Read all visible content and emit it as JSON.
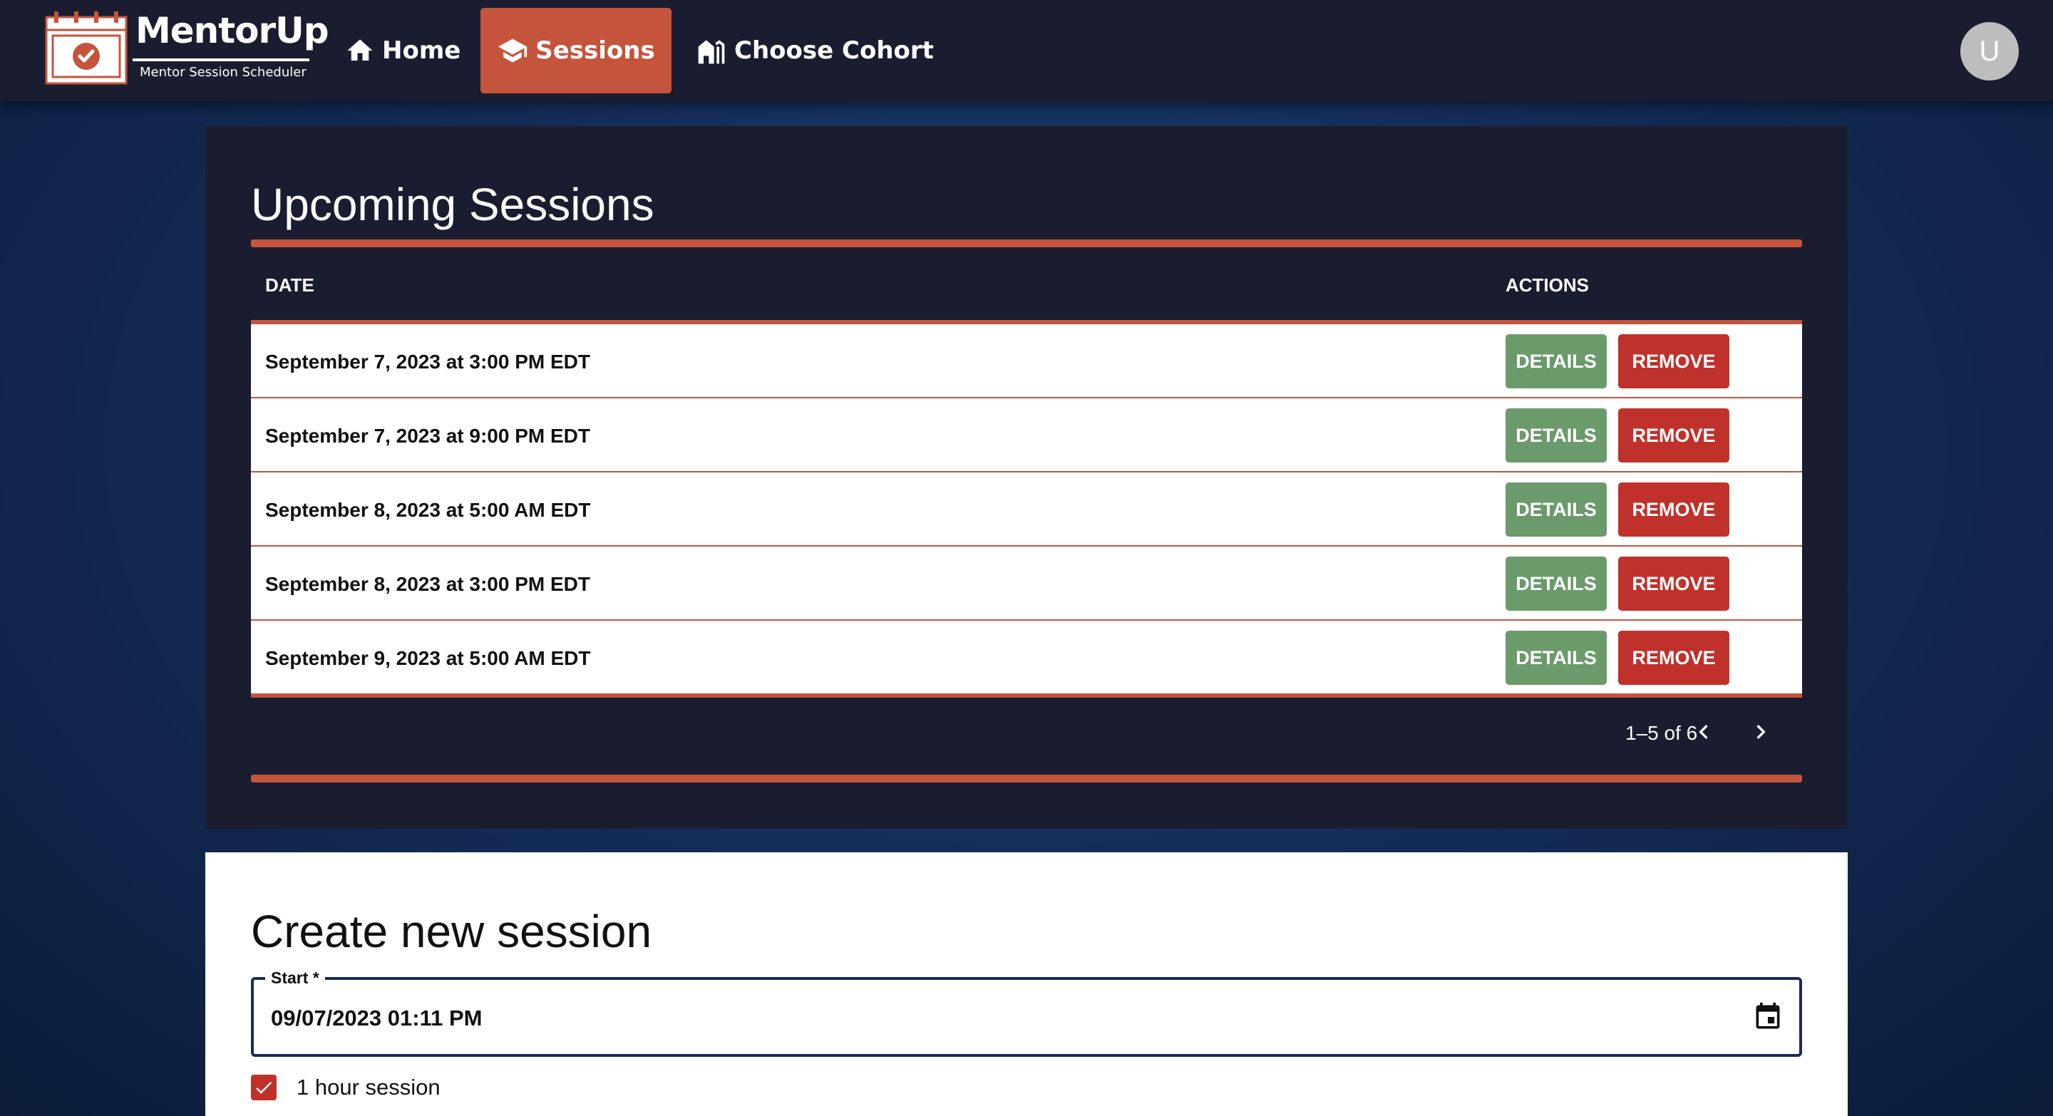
{
  "brand": {
    "name": "MentorUp",
    "tagline": "Mentor Session Scheduler"
  },
  "nav": {
    "home": "Home",
    "sessions": "Sessions",
    "cohort": "Choose Cohort",
    "active": "Sessions"
  },
  "user": {
    "avatar_initial": "U"
  },
  "upcoming": {
    "title": "Upcoming Sessions",
    "columns": {
      "date": "DATE",
      "actions": "ACTIONS"
    },
    "rows": [
      {
        "date": "September 7, 2023 at 3:00 PM EDT",
        "details": "DETAILS",
        "remove": "REMOVE"
      },
      {
        "date": "September 7, 2023 at 9:00 PM EDT",
        "details": "DETAILS",
        "remove": "REMOVE"
      },
      {
        "date": "September 8, 2023 at 5:00 AM EDT",
        "details": "DETAILS",
        "remove": "REMOVE"
      },
      {
        "date": "September 8, 2023 at 3:00 PM EDT",
        "details": "DETAILS",
        "remove": "REMOVE"
      },
      {
        "date": "September 9, 2023 at 5:00 AM EDT",
        "details": "DETAILS",
        "remove": "REMOVE"
      }
    ],
    "pagination": "1–5 of 6"
  },
  "create": {
    "title": "Create new session",
    "start_label": "Start *",
    "start_value": "09/07/2023 01:11 PM",
    "one_hour_label": "1 hour session",
    "one_hour_checked": true
  },
  "colors": {
    "accent": "#c4543c",
    "navbar": "#1a1d2f",
    "details_button": "#6b9a6b",
    "remove_button": "#c0312b"
  },
  "icons": {
    "logo": "calendar-check-icon",
    "home": "home-icon",
    "sessions": "graduation-cap-icon",
    "cohort": "cohort-building-icon",
    "prev": "chevron-left-icon",
    "next": "chevron-right-icon",
    "calendar": "calendar-icon",
    "checkbox": "check-icon"
  }
}
